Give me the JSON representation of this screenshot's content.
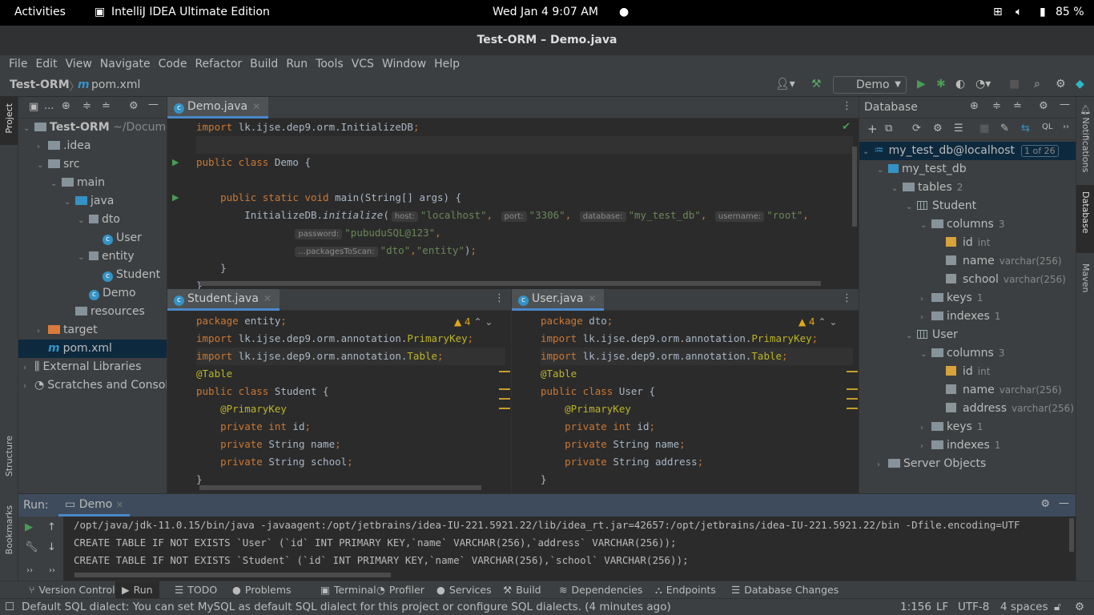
{
  "system": {
    "activities": "Activities",
    "app": "IntelliJ IDEA Ultimate Edition",
    "clock": "Wed Jan 4  9:07 AM",
    "battery": "85 %"
  },
  "window": {
    "title": "Test-ORM – Demo.java"
  },
  "menu": [
    "File",
    "Edit",
    "View",
    "Navigate",
    "Code",
    "Refactor",
    "Build",
    "Run",
    "Tools",
    "VCS",
    "Window",
    "Help"
  ],
  "breadcrumb": {
    "project": "Test-ORM",
    "file_icon": "m",
    "file": "pom.xml"
  },
  "toolbar": {
    "run_config": "Demo"
  },
  "left_stripe": {
    "project": "Project",
    "structure": "Structure",
    "bookmarks": "Bookmarks"
  },
  "right_stripe": {
    "notifications": "Notifications",
    "database": "Database",
    "maven": "Maven"
  },
  "project": {
    "header": "...",
    "tree": [
      {
        "label": "Test-ORM",
        "extra": " ~/Docume",
        "depth": 0,
        "icon": "folder",
        "open": true,
        "bold": true
      },
      {
        "label": ".idea",
        "depth": 1,
        "icon": "folder",
        "open": false
      },
      {
        "label": "src",
        "depth": 1,
        "icon": "folder",
        "open": true
      },
      {
        "label": "main",
        "depth": 2,
        "icon": "folder",
        "open": true
      },
      {
        "label": "java",
        "depth": 3,
        "icon": "folder-blue",
        "open": true
      },
      {
        "label": "dto",
        "depth": 4,
        "icon": "package",
        "open": true
      },
      {
        "label": "User",
        "depth": 5,
        "icon": "class"
      },
      {
        "label": "entity",
        "depth": 4,
        "icon": "package",
        "open": true
      },
      {
        "label": "Student",
        "depth": 5,
        "icon": "class"
      },
      {
        "label": "Demo",
        "depth": 4,
        "icon": "class"
      },
      {
        "label": "resources",
        "depth": 3,
        "icon": "folder"
      },
      {
        "label": "target",
        "depth": 1,
        "icon": "folder-orange",
        "open": false
      },
      {
        "label": "pom.xml",
        "depth": 1,
        "icon": "maven",
        "selected": true
      },
      {
        "label": "External Libraries",
        "depth": 0,
        "icon": "library",
        "open": false
      },
      {
        "label": "Scratches and Consoles",
        "depth": 0,
        "icon": "scratch",
        "open": false
      }
    ]
  },
  "editors": {
    "demo": {
      "tab": "Demo.java",
      "lines": [
        [
          [
            "k",
            "import "
          ],
          [
            "f",
            "lk.ijse.dep9.orm.InitializeDB"
          ],
          [
            "p",
            ";"
          ]
        ],
        [],
        [
          [
            "k",
            "public class "
          ],
          [
            "f",
            "Demo {"
          ]
        ],
        [],
        [
          [
            "k",
            "    public static void "
          ],
          [
            "f",
            "main(String[] args) {"
          ]
        ],
        [
          [
            "f",
            "        InitializeDB."
          ],
          [
            "i",
            "initialize"
          ],
          [
            "f",
            "("
          ],
          [
            "h",
            "host:"
          ],
          [
            "s",
            "\"localhost\""
          ],
          [
            "p",
            ", "
          ],
          [
            "h",
            "port:"
          ],
          [
            "s",
            "\"3306\""
          ],
          [
            "p",
            ", "
          ],
          [
            "h",
            "database:"
          ],
          [
            "s",
            "\"my_test_db\""
          ],
          [
            "p",
            ", "
          ],
          [
            "h",
            "username:"
          ],
          [
            "s",
            "\"root\""
          ],
          [
            "p",
            ","
          ]
        ],
        [
          [
            "f",
            "                "
          ],
          [
            "h",
            "password:"
          ],
          [
            "s",
            "\"pubuduSQL@123\""
          ],
          [
            "p",
            ","
          ]
        ],
        [
          [
            "f",
            "                "
          ],
          [
            "h",
            "...packagesToScan:"
          ],
          [
            "s",
            "\"dto\""
          ],
          [
            "p",
            ","
          ],
          [
            "s",
            "\"entity\""
          ],
          [
            "f",
            ")"
          ],
          [
            "p",
            ";"
          ]
        ],
        [
          [
            "f",
            "    }"
          ]
        ],
        [
          [
            "f",
            "}"
          ]
        ]
      ]
    },
    "student": {
      "tab": "Student.java",
      "warnings": "4",
      "lines": [
        [
          [
            "k",
            "package "
          ],
          [
            "f",
            "entity"
          ],
          [
            "p",
            ";"
          ]
        ],
        [
          [
            "k",
            "import "
          ],
          [
            "f",
            "lk.ijse.dep9.orm.annotation."
          ],
          [
            "a",
            "PrimaryKey"
          ],
          [
            "p",
            ";"
          ]
        ],
        [
          [
            "k",
            "import "
          ],
          [
            "f",
            "lk.ijse.dep9.orm.annotation."
          ],
          [
            "a",
            "Table"
          ],
          [
            "p",
            ";"
          ]
        ],
        [
          [
            "a",
            "@Table"
          ]
        ],
        [
          [
            "k",
            "public class "
          ],
          [
            "f",
            "Student {"
          ]
        ],
        [
          [
            "a",
            "    @PrimaryKey"
          ]
        ],
        [
          [
            "k",
            "    private int "
          ],
          [
            "f",
            "id"
          ],
          [
            "p",
            ";"
          ]
        ],
        [
          [
            "k",
            "    private "
          ],
          [
            "f",
            "String "
          ],
          [
            "f",
            "name"
          ],
          [
            "p",
            ";"
          ]
        ],
        [
          [
            "k",
            "    private "
          ],
          [
            "f",
            "String "
          ],
          [
            "f",
            "school"
          ],
          [
            "p",
            ";"
          ]
        ],
        [
          [
            "f",
            "}"
          ]
        ]
      ]
    },
    "user": {
      "tab": "User.java",
      "warnings": "4",
      "lines": [
        [
          [
            "k",
            "package "
          ],
          [
            "f",
            "dto"
          ],
          [
            "p",
            ";"
          ]
        ],
        [
          [
            "k",
            "import "
          ],
          [
            "f",
            "lk.ijse.dep9.orm.annotation."
          ],
          [
            "a",
            "PrimaryKey"
          ],
          [
            "p",
            ";"
          ]
        ],
        [
          [
            "k",
            "import "
          ],
          [
            "f",
            "lk.ijse.dep9.orm.annotation."
          ],
          [
            "a",
            "Table"
          ],
          [
            "p",
            ";"
          ]
        ],
        [
          [
            "a",
            "@Table"
          ]
        ],
        [
          [
            "k",
            "public class "
          ],
          [
            "f",
            "User {"
          ]
        ],
        [
          [
            "a",
            "    @PrimaryKey"
          ]
        ],
        [
          [
            "k",
            "    private int "
          ],
          [
            "f",
            "id"
          ],
          [
            "p",
            ";"
          ]
        ],
        [
          [
            "k",
            "    private "
          ],
          [
            "f",
            "String "
          ],
          [
            "f",
            "name"
          ],
          [
            "p",
            ";"
          ]
        ],
        [
          [
            "k",
            "    private "
          ],
          [
            "f",
            "String "
          ],
          [
            "f",
            "address"
          ],
          [
            "p",
            ";"
          ]
        ],
        [
          [
            "f",
            "}"
          ]
        ]
      ]
    }
  },
  "database": {
    "title": "Database",
    "tree": [
      {
        "label": "my_test_db@localhost",
        "badge": "1 of 26",
        "depth": 0,
        "icon": "mysql",
        "open": true,
        "selected": true
      },
      {
        "label": "my_test_db",
        "depth": 1,
        "icon": "schema",
        "open": true
      },
      {
        "label": "tables",
        "meta": "2",
        "depth": 2,
        "icon": "folder",
        "open": true
      },
      {
        "label": "Student",
        "depth": 3,
        "icon": "table",
        "open": true
      },
      {
        "label": "columns",
        "meta": "3",
        "depth": 4,
        "icon": "folder",
        "open": true
      },
      {
        "label": "id",
        "meta": "int",
        "depth": 5,
        "icon": "key-column"
      },
      {
        "label": "name",
        "meta": "varchar(256)",
        "depth": 5,
        "icon": "column"
      },
      {
        "label": "school",
        "meta": "varchar(256)",
        "depth": 5,
        "icon": "column"
      },
      {
        "label": "keys",
        "meta": "1",
        "depth": 4,
        "icon": "folder",
        "open": false
      },
      {
        "label": "indexes",
        "meta": "1",
        "depth": 4,
        "icon": "folder",
        "open": false
      },
      {
        "label": "User",
        "depth": 3,
        "icon": "table",
        "open": true
      },
      {
        "label": "columns",
        "meta": "3",
        "depth": 4,
        "icon": "folder",
        "open": true
      },
      {
        "label": "id",
        "meta": "int",
        "depth": 5,
        "icon": "key-column"
      },
      {
        "label": "name",
        "meta": "varchar(256)",
        "depth": 5,
        "icon": "column"
      },
      {
        "label": "address",
        "meta": "varchar(256)",
        "depth": 5,
        "icon": "column"
      },
      {
        "label": "keys",
        "meta": "1",
        "depth": 4,
        "icon": "folder",
        "open": false
      },
      {
        "label": "indexes",
        "meta": "1",
        "depth": 4,
        "icon": "folder",
        "open": false
      },
      {
        "label": "Server Objects",
        "depth": 1,
        "icon": "folder",
        "open": false
      }
    ]
  },
  "run": {
    "label": "Run:",
    "tab": "Demo",
    "output": [
      "/opt/java/jdk-11.0.15/bin/java -javaagent:/opt/jetbrains/idea-IU-221.5921.22/lib/idea_rt.jar=42657:/opt/jetbrains/idea-IU-221.5921.22/bin -Dfile.encoding=UTF",
      "CREATE TABLE IF NOT EXISTS `User` (`id` INT PRIMARY KEY,`name` VARCHAR(256),`address` VARCHAR(256));",
      "CREATE TABLE IF NOT EXISTS `Student` (`id` INT PRIMARY KEY,`name` VARCHAR(256),`school` VARCHAR(256));"
    ]
  },
  "tool_windows": [
    "Version Control",
    "Run",
    "TODO",
    "Problems",
    "Terminal",
    "Profiler",
    "Services",
    "Build",
    "Dependencies",
    "Endpoints",
    "Database Changes"
  ],
  "status": {
    "message": "Default SQL dialect: You can set MySQL as default SQL dialect for this project or configure SQL dialects. (4 minutes ago)",
    "position": "1:156",
    "line_sep": "LF",
    "encoding": "UTF-8",
    "indent": "4 spaces"
  }
}
